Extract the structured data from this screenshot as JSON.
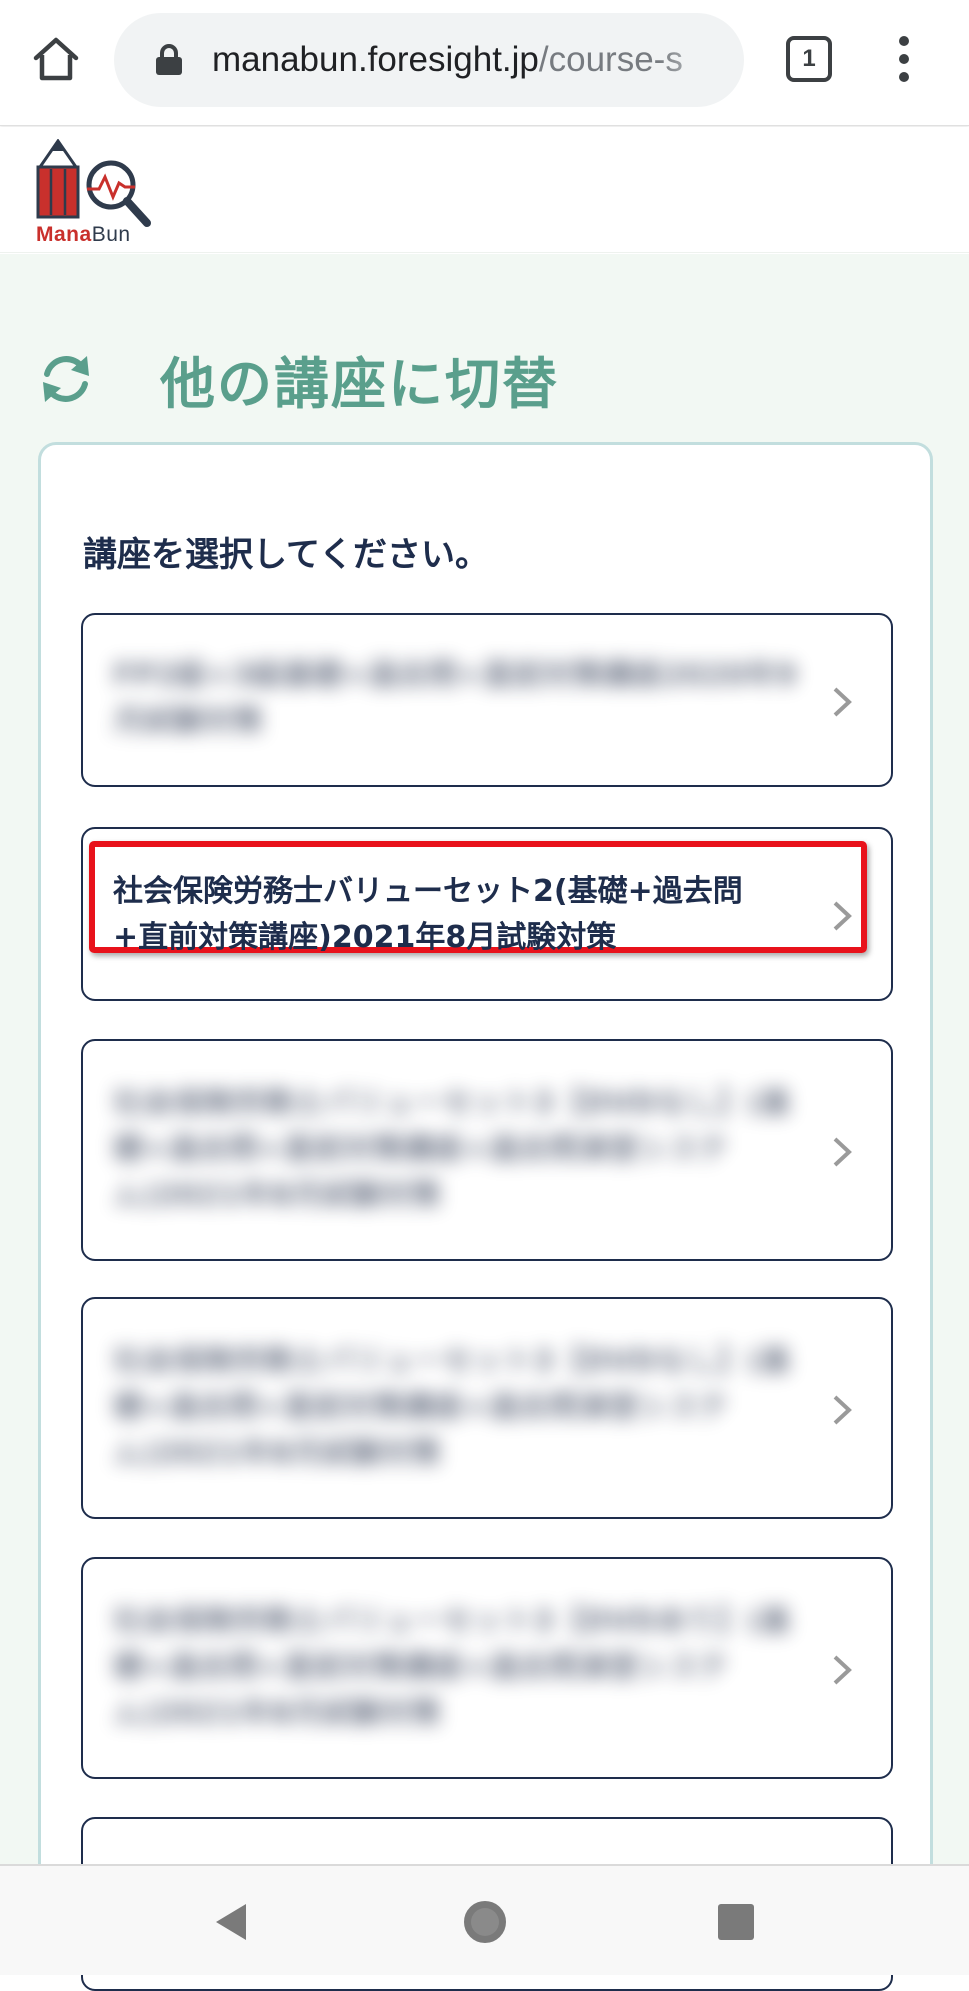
{
  "browser": {
    "url_host": "manabun.foresight.jp",
    "url_path": "/course-s",
    "tab_count": "1",
    "icons": [
      "home-icon",
      "lock-icon",
      "tabs-icon",
      "more-vert-icon"
    ]
  },
  "header": {
    "logo_text_a": "Mana",
    "logo_text_b": "Bun",
    "icons": [
      "pencil-icon",
      "magnifier-chart-icon"
    ]
  },
  "main": {
    "title": "他の講座に切替",
    "title_icon": "refresh-icon",
    "prompt": "講座を選択してください。",
    "courses": [
      {
        "label": "FP2級+3級基礎+過去問+直前対策講座2020年9月試験対策",
        "blurred": true
      },
      {
        "label": "社会保険労務士バリューセット2(基礎+過去問+直前対策講座)2021年8月試験対策",
        "blurred": false,
        "highlighted": true
      },
      {
        "label": "社会保険労務士バリューセット3【DVDなし】(基礎+過去問+直前対策講座+過去問演習システム)2021年8月試験対策",
        "blurred": true
      },
      {
        "label": "社会保険労務士バリューセット3【DVDなし】(基礎+過去問+直前対策講座+過去問演習システム)2021年8月試験対策",
        "blurred": true
      },
      {
        "label": "社会保険労務士バリューセット3【DVDあり】(基礎+過去問+直前対策講座+過去問演習システム)2021年8月試験対策",
        "blurred": true
      }
    ],
    "chevron_icon": "chevron-right-icon",
    "accent_color": "#5a9f8c",
    "highlight_color": "#e8121b"
  },
  "navbar": {
    "icons": [
      "back-triangle-icon",
      "home-circle-icon",
      "recents-square-icon"
    ]
  }
}
